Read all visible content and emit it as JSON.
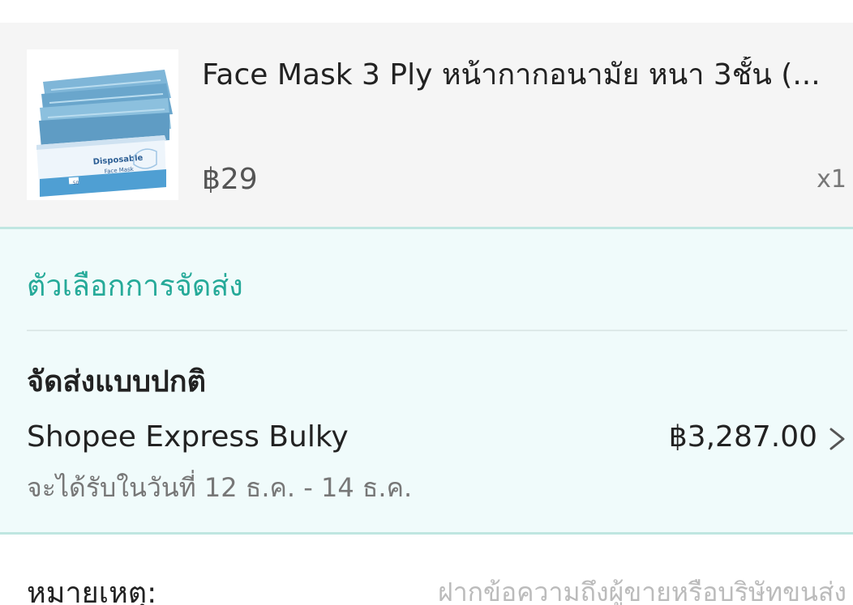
{
  "product": {
    "title": "Face Mask 3 Ply หน้ากากอนามัย หนา 3ชั้น (...",
    "price": "฿29",
    "quantity": "x1",
    "image_text": {
      "brand": "Disposable",
      "subtitle": "Face Mask",
      "count": "50"
    }
  },
  "shipping": {
    "header": "ตัวเลือกการจัดส่ง",
    "type_label": "จัดส่งแบบปกติ",
    "carrier": "Shopee Express Bulky",
    "fee": "฿3,287.00",
    "delivery_estimate": "จะได้รับในวันที่ 12 ธ.ค. - 14 ธ.ค."
  },
  "note": {
    "label": "หมายเหตุ:",
    "placeholder": "ฝากข้อความถึงผู้ขายหรือบริษัทขนส่ง"
  },
  "colors": {
    "accent": "#26aa99",
    "shipping_bg": "#f0fbfb",
    "product_bg": "#f5f5f5"
  },
  "icons": {
    "chevron": "chevron-right-icon"
  }
}
